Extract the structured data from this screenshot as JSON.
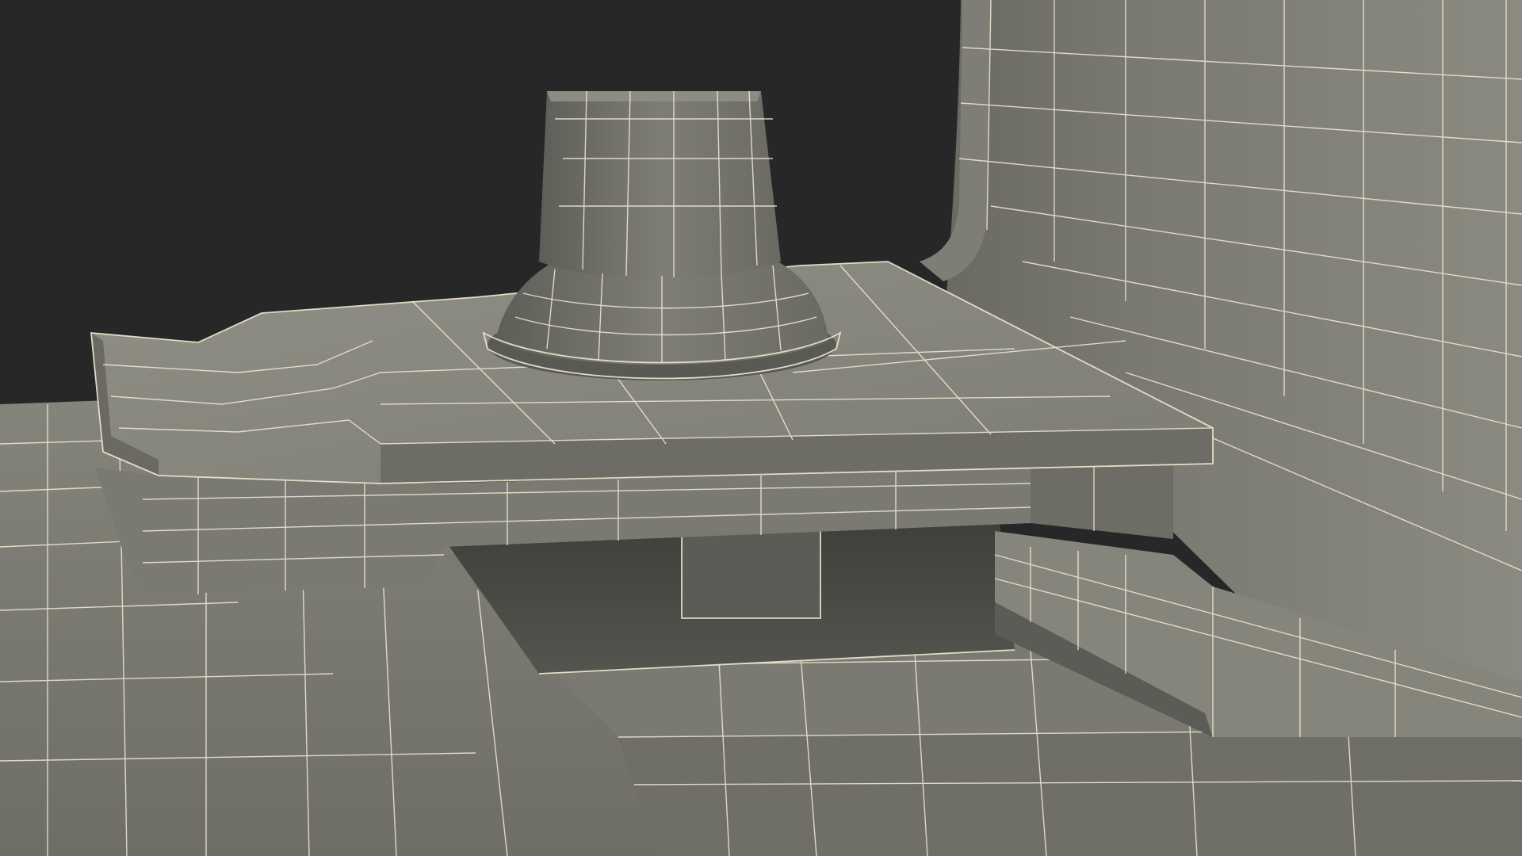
{
  "scene": {
    "subject": "wireframe-render",
    "colors": {
      "background": "#262727",
      "surface_light": "#8e8e84",
      "surface_mid": "#6d6d65",
      "surface_dark": "#4a4a45",
      "wire": "#f2ecd6"
    }
  }
}
